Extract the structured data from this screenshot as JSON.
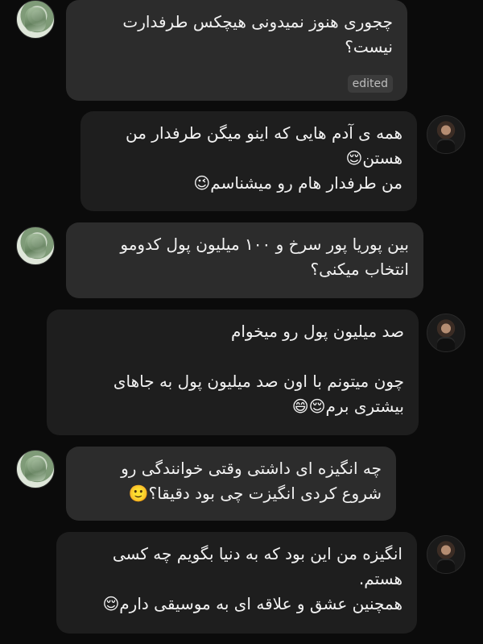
{
  "messages": [
    {
      "side": "in",
      "lines": [
        "چجوری هنوز نمیدونی هیچکس طرفدارت",
        "نیست؟"
      ],
      "badge": "edited"
    },
    {
      "side": "out",
      "lines": [
        "همه ی آدم هایی که اینو میگن طرفدار من",
        "هستن😌",
        "من طرفدار هام رو میشناسم😉"
      ]
    },
    {
      "side": "in",
      "lines": [
        "بین پوریا پور سرخ و ۱۰۰ میلیون پول کدومو",
        "انتخاب میکنی؟"
      ]
    },
    {
      "side": "out",
      "lines": [
        "صد میلیون پول رو میخوام",
        "",
        "چون میتونم با اون صد میلیون پول به جاهای",
        "بیشتری برم😌😄"
      ]
    },
    {
      "side": "in",
      "lines": [
        "چه انگیزه ای داشتی وقتی خوانندگی رو",
        "شروع کردی انگیزت چی بود دقیقا؟🙂"
      ]
    },
    {
      "side": "out",
      "lines": [
        "انگیزه من این بود که به دنیا بگویم چه کسی",
        "هستم.",
        "همچنین عشق و علاقه ای به موسیقی دارم😌"
      ]
    }
  ]
}
